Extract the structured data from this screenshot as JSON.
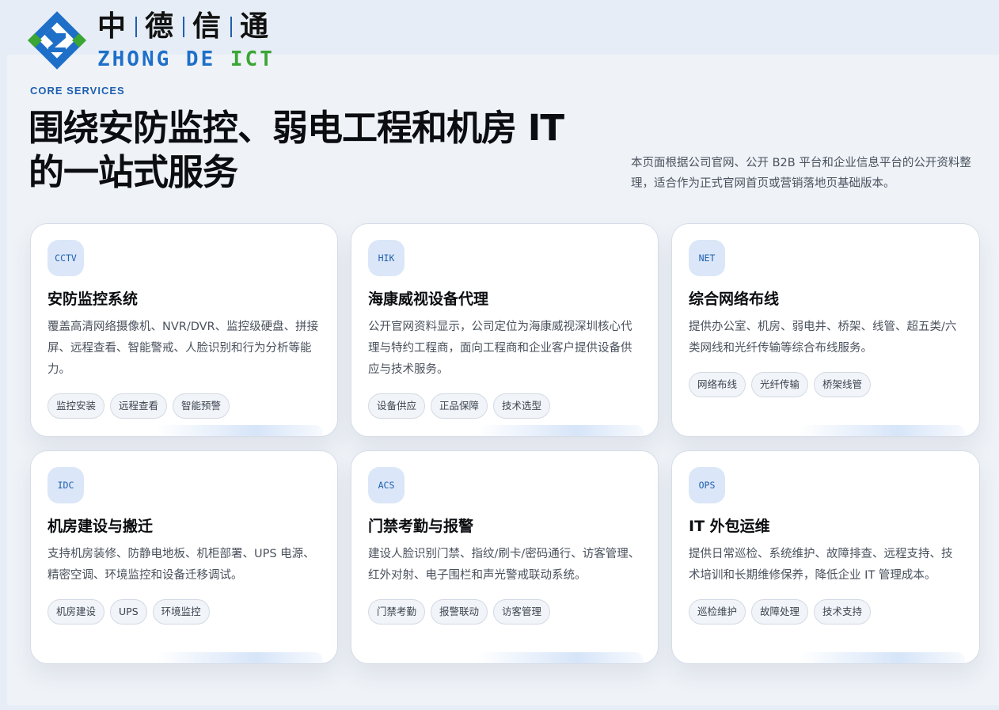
{
  "brand": {
    "cn_chars": [
      "中",
      "德",
      "信",
      "通"
    ],
    "en_part1": "ZHONG DE ",
    "en_part2": "ICT",
    "colors": {
      "blue": "#1e6fc8",
      "green": "#3aa634",
      "accent": "#1f5fb0"
    }
  },
  "hero": {
    "eyebrow": "CORE SERVICES",
    "headline": "围绕安防监控、弱电工程和机房 IT 的一站式服务",
    "intro": "本页面根据公司官网、公开 B2B 平台和企业信息平台的公开资料整理，适合作为正式官网首页或营销落地页基础版本。"
  },
  "services": [
    {
      "code": "CCTV",
      "title": "安防监控系统",
      "desc": "覆盖高清网络摄像机、NVR/DVR、监控级硬盘、拼接屏、远程查看、智能警戒、人脸识别和行为分析等能力。",
      "tags": [
        "监控安装",
        "远程查看",
        "智能预警"
      ]
    },
    {
      "code": "HIK",
      "title": "海康威视设备代理",
      "desc": "公开官网资料显示，公司定位为海康威视深圳核心代理与特约工程商，面向工程商和企业客户提供设备供应与技术服务。",
      "tags": [
        "设备供应",
        "正品保障",
        "技术选型"
      ]
    },
    {
      "code": "NET",
      "title": "综合网络布线",
      "desc": "提供办公室、机房、弱电井、桥架、线管、超五类/六类网线和光纤传输等综合布线服务。",
      "tags": [
        "网络布线",
        "光纤传输",
        "桥架线管"
      ]
    },
    {
      "code": "IDC",
      "title": "机房建设与搬迁",
      "desc": "支持机房装修、防静电地板、机柜部署、UPS 电源、精密空调、环境监控和设备迁移调试。",
      "tags": [
        "机房建设",
        "UPS",
        "环境监控"
      ]
    },
    {
      "code": "ACS",
      "title": "门禁考勤与报警",
      "desc": "建设人脸识别门禁、指纹/刷卡/密码通行、访客管理、红外对射、电子围栏和声光警戒联动系统。",
      "tags": [
        "门禁考勤",
        "报警联动",
        "访客管理"
      ]
    },
    {
      "code": "OPS",
      "title": "IT 外包运维",
      "desc": "提供日常巡检、系统维护、故障排查、远程支持、技术培训和长期维修保养，降低企业 IT 管理成本。",
      "tags": [
        "巡检维护",
        "故障处理",
        "技术支持"
      ]
    }
  ]
}
